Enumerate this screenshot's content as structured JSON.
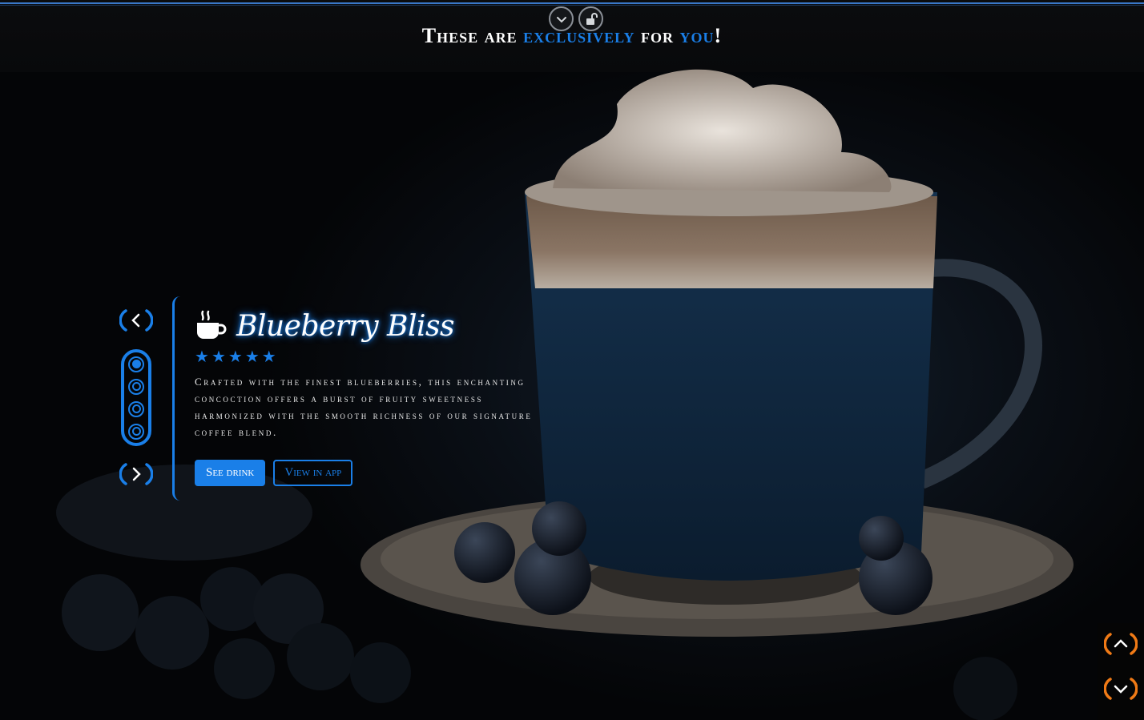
{
  "header": {
    "part1": "These are ",
    "accent1": "exclusively",
    "part2": " for ",
    "accent2": "you",
    "part3": "!"
  },
  "top_controls": {
    "collapse_icon": "chevron-down-icon",
    "lock_icon": "unlock-icon"
  },
  "drink": {
    "icon": "coffee-cup-icon",
    "title": "Blueberry Bliss",
    "rating": 5,
    "description": "Crafted with the finest blueberries, this enchanting concoction offers a burst of fruity sweetness harmonized with the smooth richness of our signature coffee blend.",
    "see_label": "See drink",
    "app_label": "View in app"
  },
  "slider_nav": {
    "prev_icon": "chevron-left-icon",
    "next_icon": "chevron-right-icon",
    "slide_count": 4,
    "active_index": 0
  },
  "page_nav": {
    "up_icon": "chevron-up-icon",
    "down_icon": "chevron-down-icon"
  },
  "colors": {
    "accent": "#1a7fe8",
    "orange": "#f07a16",
    "background": "#050608"
  }
}
